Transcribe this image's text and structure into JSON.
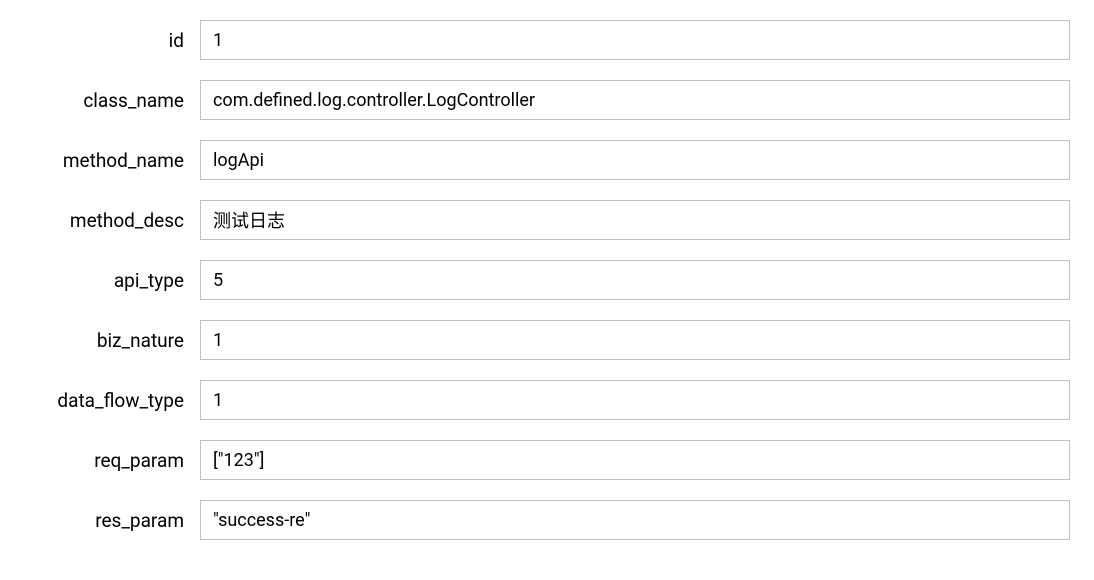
{
  "form": {
    "rows": [
      {
        "label": "id",
        "value": "1",
        "name": "id"
      },
      {
        "label": "class_name",
        "value": "com.defined.log.controller.LogController",
        "name": "class-name"
      },
      {
        "label": "method_name",
        "value": "logApi",
        "name": "method-name"
      },
      {
        "label": "method_desc",
        "value": "测试日志",
        "name": "method-desc"
      },
      {
        "label": "api_type",
        "value": "5",
        "name": "api-type"
      },
      {
        "label": "biz_nature",
        "value": "1",
        "name": "biz-nature"
      },
      {
        "label": "data_flow_type",
        "value": "1",
        "name": "data-flow-type"
      },
      {
        "label": "req_param",
        "value": "[\"123\"]",
        "name": "req-param"
      },
      {
        "label": "res_param",
        "value": "\"success-re\"",
        "name": "res-param"
      }
    ]
  }
}
